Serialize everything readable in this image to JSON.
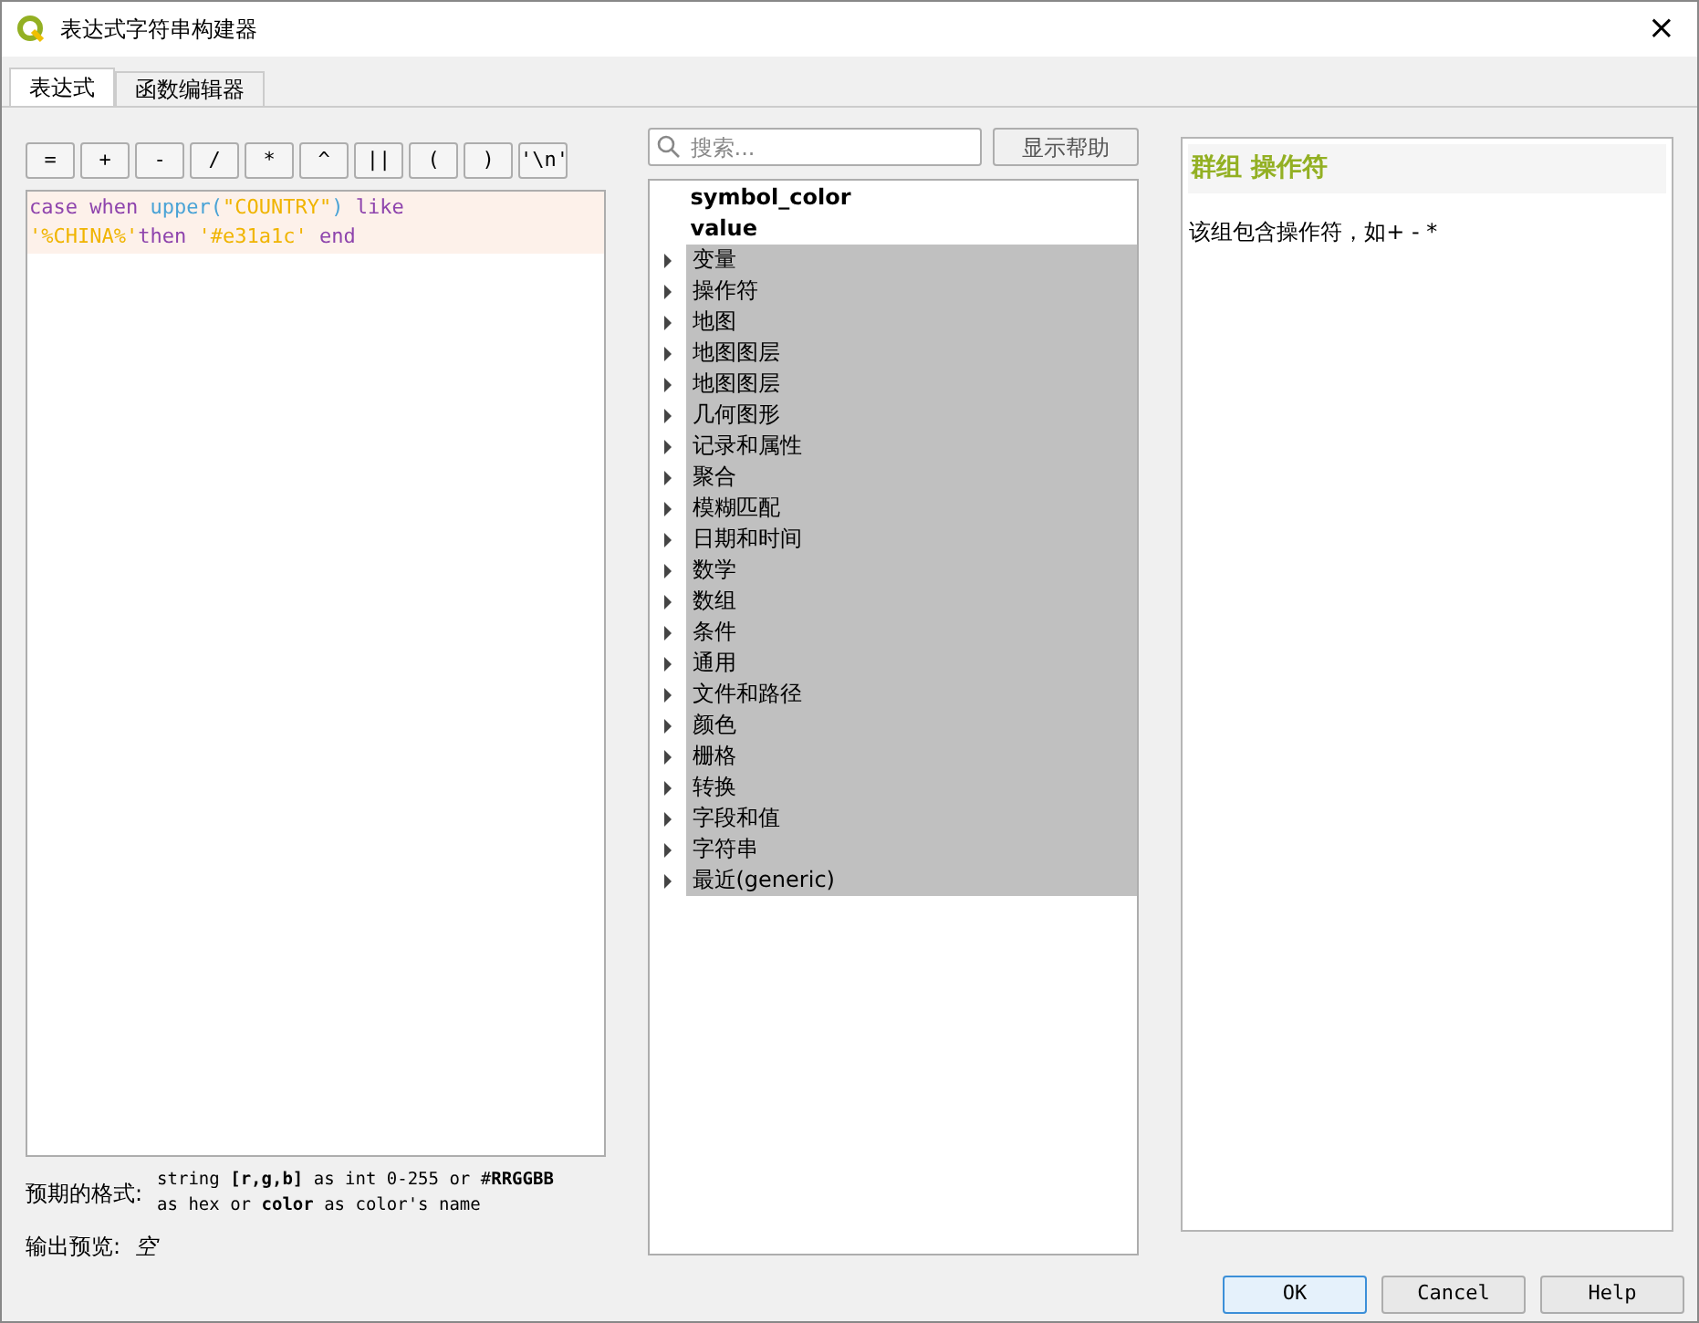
{
  "window": {
    "title": "表达式字符串构建器",
    "close": "×"
  },
  "tabs": [
    {
      "label": "表达式",
      "selected": true
    },
    {
      "label": "函数编辑器",
      "selected": false
    }
  ],
  "operators": [
    "=",
    "+",
    "-",
    "/",
    "*",
    "^",
    "||",
    "(",
    ")",
    "'\\n'"
  ],
  "editor": {
    "lines": [
      [
        {
          "text": "case when ",
          "color": "#8e44ad"
        },
        {
          "text": "upper(",
          "color": "#4aa3d6"
        },
        {
          "text": "\"COUNTRY\"",
          "color": "#f0b400"
        },
        {
          "text": ") ",
          "color": "#4aa3d6"
        },
        {
          "text": "like",
          "color": "#8e44ad"
        }
      ],
      [
        {
          "text": "'%CHINA%'",
          "color": "#f0b400"
        },
        {
          "text": "then ",
          "color": "#8e44ad"
        },
        {
          "text": "'#e31a1c'",
          "color": "#f0b400"
        },
        {
          "text": " end",
          "color": "#8e44ad"
        }
      ]
    ]
  },
  "format": {
    "label": "预期的格式:",
    "lines": [
      "string **[r,g,b]** as int 0-255 or #**RRGGBB**",
      "as hex or **color** as color's name"
    ]
  },
  "preview": {
    "label": "输出预览:",
    "value": "空"
  },
  "search": {
    "placeholder": "搜索..."
  },
  "show_help_button": "显示帮助",
  "tree": [
    {
      "label": "symbol_color",
      "kind": "field"
    },
    {
      "label": "value",
      "kind": "field"
    },
    {
      "label": "变量",
      "kind": "group",
      "expanded": false
    },
    {
      "label": "操作符",
      "kind": "group",
      "expanded": false
    },
    {
      "label": "地图",
      "kind": "group",
      "expanded": false
    },
    {
      "label": "地图图层",
      "kind": "group",
      "expanded": false
    },
    {
      "label": "地图图层",
      "kind": "group",
      "expanded": false
    },
    {
      "label": "几何图形",
      "kind": "group",
      "expanded": false
    },
    {
      "label": "记录和属性",
      "kind": "group",
      "expanded": false
    },
    {
      "label": "聚合",
      "kind": "group",
      "expanded": false
    },
    {
      "label": "模糊匹配",
      "kind": "group",
      "expanded": false
    },
    {
      "label": "日期和时间",
      "kind": "group",
      "expanded": false
    },
    {
      "label": "数学",
      "kind": "group",
      "expanded": false
    },
    {
      "label": "数组",
      "kind": "group",
      "expanded": false
    },
    {
      "label": "条件",
      "kind": "group",
      "expanded": false
    },
    {
      "label": "通用",
      "kind": "group",
      "expanded": false
    },
    {
      "label": "文件和路径",
      "kind": "group",
      "expanded": false
    },
    {
      "label": "颜色",
      "kind": "group",
      "expanded": false
    },
    {
      "label": "栅格",
      "kind": "group",
      "expanded": false
    },
    {
      "label": "转换",
      "kind": "group",
      "expanded": false
    },
    {
      "label": "字段和值",
      "kind": "group",
      "expanded": false
    },
    {
      "label": "字符串",
      "kind": "group",
      "expanded": false
    },
    {
      "label": "最近(generic)",
      "kind": "group",
      "expanded": false
    }
  ],
  "help": {
    "title": "群组 操作符",
    "text": "该组包含操作符，如+ - *"
  },
  "buttons": [
    "OK",
    "Cancel",
    "Help"
  ]
}
